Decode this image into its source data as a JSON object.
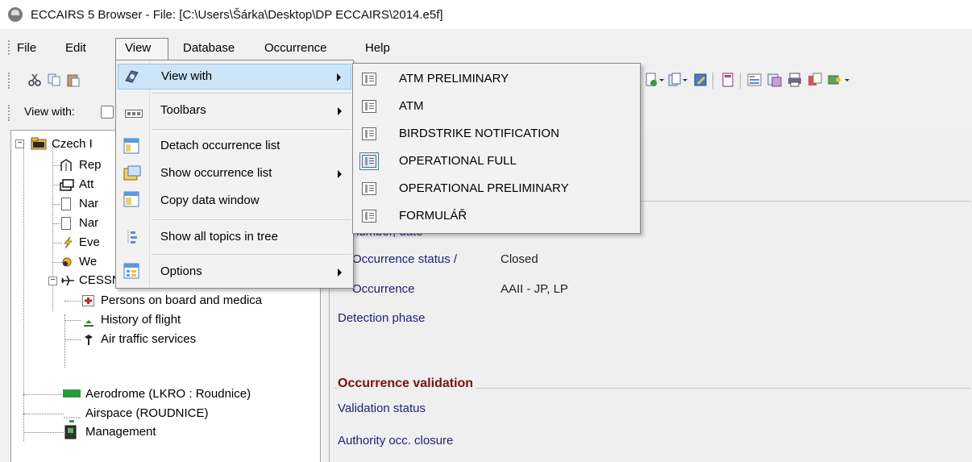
{
  "window": {
    "title": "ECCAIRS 5 Browser - File: [C:\\Users\\Šárka\\Desktop\\DP ECCAIRS\\2014.e5f]"
  },
  "menubar": {
    "file": "File",
    "edit": "Edit",
    "view": "View",
    "database": "Database",
    "occurrence": "Occurrence",
    "help": "Help"
  },
  "viewbar": {
    "label": "View with:"
  },
  "tree": {
    "root_label": "Czech I",
    "items": [
      {
        "label": "Rep"
      },
      {
        "label": "Att"
      },
      {
        "label": "Nar"
      },
      {
        "label": "Nar"
      },
      {
        "label": "Eve"
      },
      {
        "label": "We"
      }
    ],
    "aircraft": {
      "label": "CESSNA - 172 - H, OK-ACP",
      "children": [
        {
          "label": "Persons on board and medica"
        },
        {
          "label": "History of flight"
        },
        {
          "label": "Air traffic services"
        }
      ]
    },
    "aerodrome": "Aerodrome (LKRO : Roudnice)",
    "airspace": "Airspace (ROUDNICE)",
    "management": "Management"
  },
  "detail": {
    "partial_field": "number, date",
    "status_label": "Occurrence status /",
    "status_value": "Closed",
    "occurrence_label": "Occurrence",
    "occurrence_value": "AAII - JP, LP",
    "detection_label": "Detection phase",
    "validation_section": "Occurrence validation",
    "validation_status_label": "Validation status",
    "authority_closure_label": "Authority occ. closure"
  },
  "view_menu": {
    "items": [
      {
        "label": "View with",
        "icon": "eye-icon",
        "submenu": true,
        "highlighted": true
      },
      {
        "label": "Toolbars",
        "icon": "toolbar-icon",
        "submenu": true
      },
      {
        "label": "Detach occurrence list",
        "icon": "detach-list-icon",
        "submenu": false
      },
      {
        "label": "Show occurrence list",
        "icon": "show-list-icon",
        "submenu": true
      },
      {
        "label": "Copy data window",
        "icon": "copy-window-icon",
        "submenu": false
      },
      {
        "label": "Show all topics in tree",
        "icon": "tree-topics-icon",
        "submenu": false
      },
      {
        "label": "Options",
        "icon": "options-icon",
        "submenu": true
      }
    ]
  },
  "view_with_submenu": {
    "items": [
      {
        "label": "ATM PRELIMINARY",
        "checked": false
      },
      {
        "label": "ATM",
        "checked": false
      },
      {
        "label": "BIRDSTRIKE NOTIFICATION",
        "checked": false
      },
      {
        "label": "OPERATIONAL FULL",
        "checked": true
      },
      {
        "label": "OPERATIONAL PRELIMINARY",
        "checked": false
      },
      {
        "label": "FORMULÁŘ",
        "checked": false
      }
    ]
  },
  "colors": {
    "highlight": "#cce4f7",
    "field_label": "#1f1f7a",
    "section_title": "#7a1010"
  }
}
